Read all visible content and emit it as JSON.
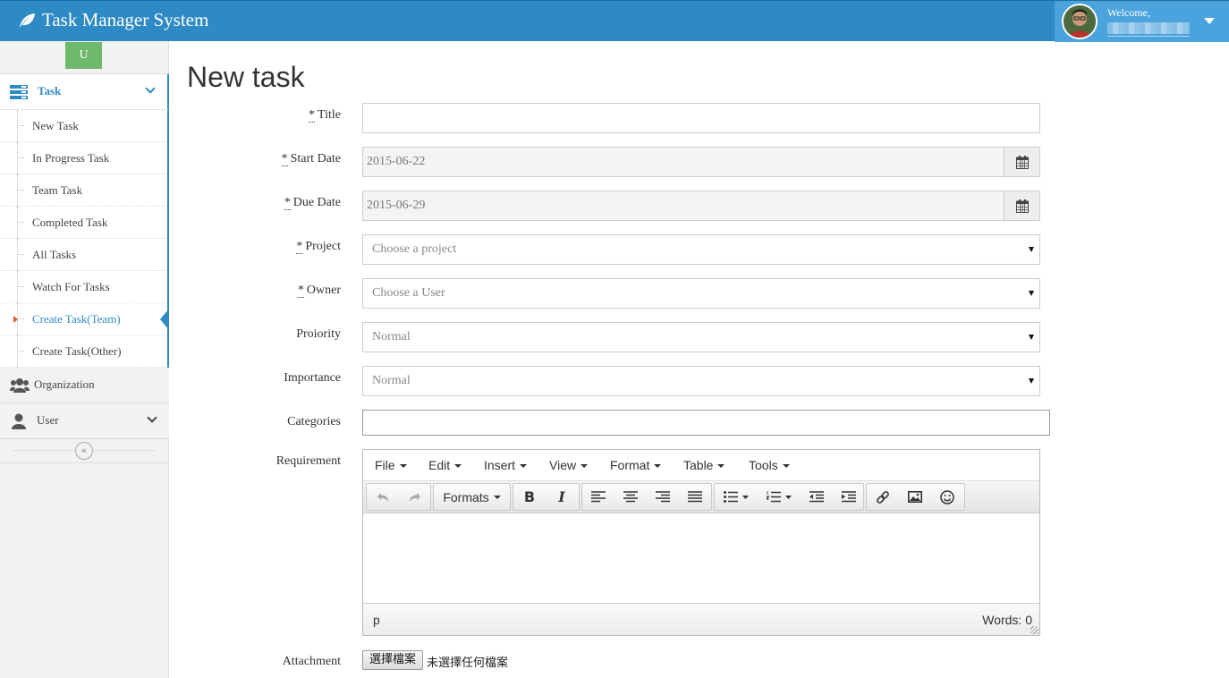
{
  "header": {
    "brand": "Task Manager System",
    "welcome": "Welcome,"
  },
  "sidebar": {
    "badge": "U",
    "task_label": "Task",
    "items": [
      {
        "label": "New Task"
      },
      {
        "label": "In Progress Task"
      },
      {
        "label": "Team Task"
      },
      {
        "label": "Completed Task"
      },
      {
        "label": "All Tasks"
      },
      {
        "label": "Watch For Tasks"
      },
      {
        "label": "Create Task(Team)",
        "active": true
      },
      {
        "label": "Create Task(Other)"
      }
    ],
    "organization_label": "Organization",
    "user_label": "User",
    "collapse_glyph": "«"
  },
  "main": {
    "title": "New task",
    "form": {
      "title_label": "Title",
      "start_label": "Start Date",
      "start_value": "2015-06-22",
      "due_label": "Due Date",
      "due_value": "2015-06-29",
      "project_label": "Project",
      "project_value": "Choose a project",
      "owner_label": "Owner",
      "owner_value": "Choose a User",
      "priority_label": "Proiority",
      "priority_value": "Normal",
      "importance_label": "Importance",
      "importance_value": "Normal",
      "categories_label": "Categories",
      "requirement_label": "Requirement",
      "attachment_label": "Attachment",
      "required_mark": "*"
    },
    "editor": {
      "menus": [
        "File",
        "Edit",
        "Insert",
        "View",
        "Format",
        "Table",
        "Tools"
      ],
      "formats_label": "Formats",
      "status_path": "p",
      "word_count": "Words: 0"
    },
    "file": {
      "button_label": "選擇檔案",
      "no_file_text": "未選擇任何檔案"
    }
  },
  "colors": {
    "header_bg": "#2d8ac4",
    "user_box_bg": "#4aa3dc",
    "accent": "#2d8ac4",
    "badge_bg": "#6fba6a",
    "active_arrow": "#e05a2b"
  }
}
